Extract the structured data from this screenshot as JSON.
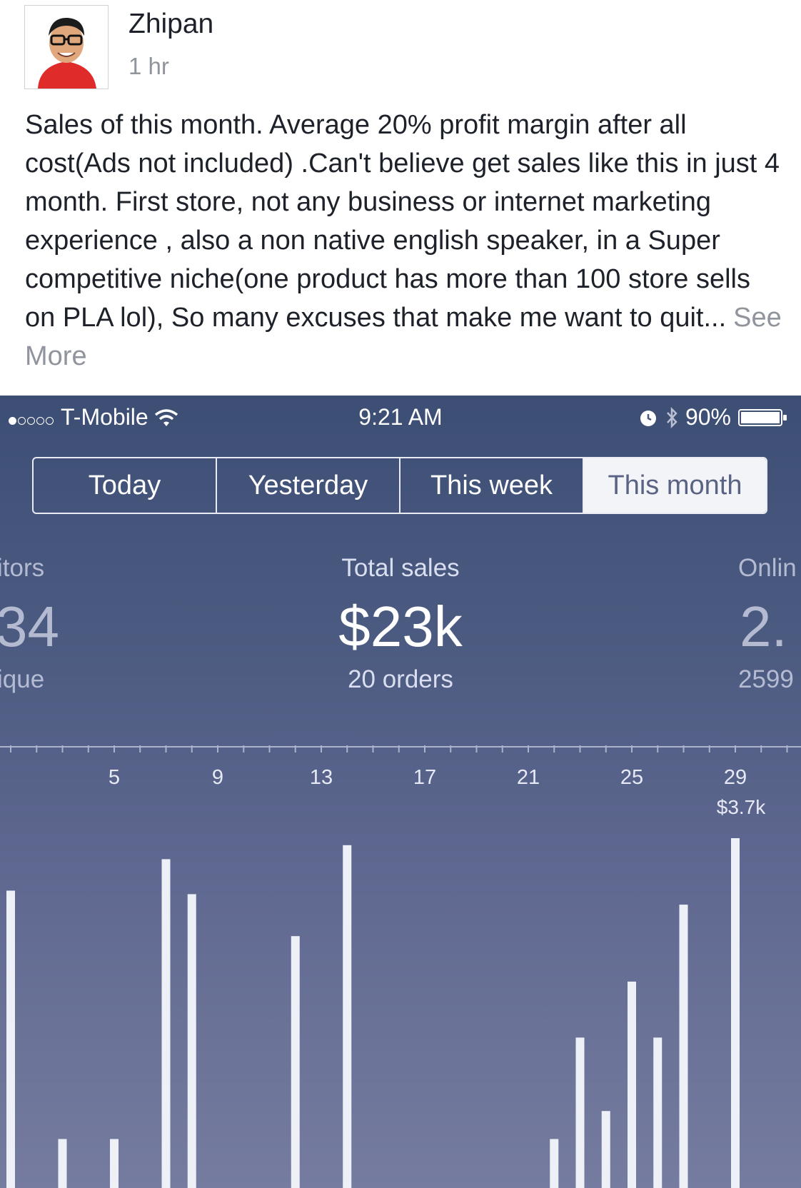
{
  "post": {
    "author": "Zhipan",
    "time": "1 hr",
    "text": "Sales of this month. Average 20% profit margin after all cost(Ads not included) .Can't believe get sales like this in just 4 month. First store, not any business or internet marketing experience , also a non native english speaker, in a Super competitive niche(one product has more than 100 store sells on PLA lol), So many excuses that make me want to quit...",
    "see_more": "See More"
  },
  "status_bar": {
    "carrier": "T-Mobile",
    "time": "9:21 AM",
    "battery": "90%",
    "icons": [
      "signal-dots-icon",
      "wifi-icon",
      "alarm-icon",
      "bluetooth-icon",
      "battery-icon"
    ]
  },
  "tabs": [
    {
      "label": "Today",
      "active": false
    },
    {
      "label": "Yesterday",
      "active": false
    },
    {
      "label": "This week",
      "active": false
    },
    {
      "label": "This month",
      "active": true
    }
  ],
  "metrics": {
    "left": {
      "label": "itors",
      "value": "34",
      "sub": "ique"
    },
    "center": {
      "label": "Total sales",
      "value": "$23k",
      "sub": "20 orders"
    },
    "right": {
      "label": "Onlin",
      "value": "2.",
      "sub": "2599"
    }
  },
  "chart_data": {
    "type": "bar",
    "x_ticks": [
      "5",
      "9",
      "13",
      "17",
      "21",
      "25",
      "29"
    ],
    "x": [
      1,
      3,
      5,
      7,
      8,
      12,
      14,
      22,
      23,
      24,
      25,
      26,
      27,
      29
    ],
    "values": [
      0.85,
      0.14,
      0.14,
      0.94,
      0.84,
      0.72,
      0.98,
      0.14,
      0.43,
      0.22,
      0.59,
      0.43,
      0.81,
      1.0
    ],
    "annotation": "$3.7k",
    "colors": {
      "bar": "#eef0f7",
      "tick": "#aab2cc"
    }
  }
}
